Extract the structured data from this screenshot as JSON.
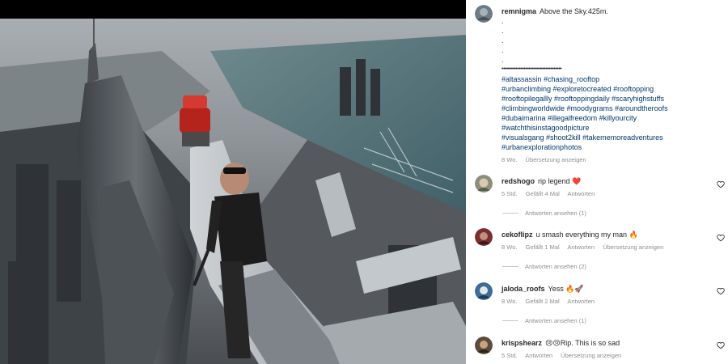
{
  "caption": {
    "username": "remnigma",
    "text": "Above the Sky.425m.",
    "dot_lines": [
      ".",
      ".",
      ".",
      ".",
      "."
    ],
    "separator": "••••••••••••••••••••••••••••••••••••••",
    "hashtag_lines": [
      "#altassassin #chasing_rooftop",
      "#urbanclimbing #exploretocreated #rooftopping",
      "#rooftopilegallly #rooftoppingdaily #scaryhighstuffs",
      "#climbingworldwide #moodygrams #aroundtheroofs",
      "#dubaimarina #illegalfreedom #killyourcity",
      "#watchthisinstagoodpicture",
      "#visualsgang #shoot2kill #takememoreadventures",
      "#urbanexplorationphotos"
    ],
    "time": "8 Wo.",
    "translate": "Übersetzung anzeigen"
  },
  "comments": [
    {
      "username": "redshogo",
      "text": "rip legend ❤️",
      "time": "5 Std.",
      "likes": "Gefällt 4 Mal",
      "reply": "Antworten",
      "translate": "",
      "view_replies": "Antworten ansehen (1)"
    },
    {
      "username": "cekoflipz",
      "text": "u smash everything my man 🔥",
      "time": "8 Wo.",
      "likes": "Gefällt 1 Mal",
      "reply": "Antworten",
      "translate": "Übersetzung anzeigen",
      "view_replies": "Antworten ansehen (2)"
    },
    {
      "username": "jaloda_roofs",
      "text": "Yess 🔥🚀",
      "time": "8 Wo.",
      "likes": "Gefällt 2 Mal",
      "reply": "Antworten",
      "translate": "",
      "view_replies": "Antworten ansehen (1)"
    },
    {
      "username": "krispshearz",
      "text": "😢😢Rip. This is so sad",
      "time": "5 Std.",
      "likes": "",
      "reply": "Antworten",
      "translate": "Übersetzung anzeigen",
      "view_replies": ""
    }
  ]
}
